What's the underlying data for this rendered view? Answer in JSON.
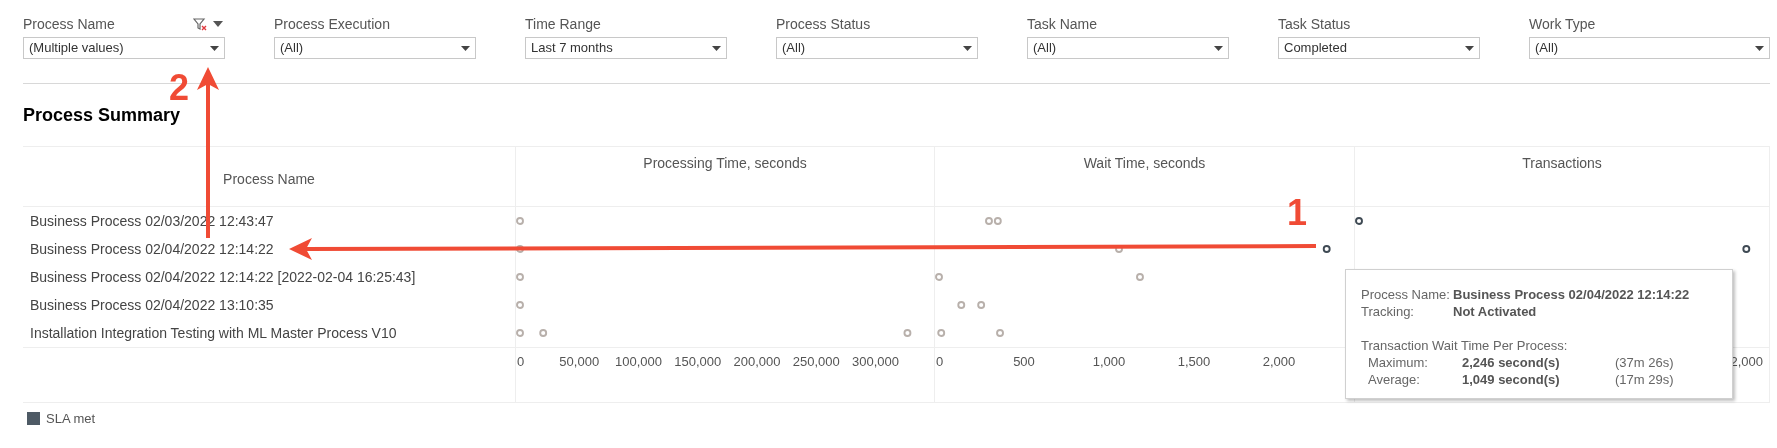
{
  "filters": [
    {
      "label": "Process Name",
      "value": "(Multiple values)",
      "filter_actions": true
    },
    {
      "label": "Process Execution",
      "value": "(All)",
      "filter_actions": false
    },
    {
      "label": "Time Range",
      "value": "Last 7 months",
      "filter_actions": false
    },
    {
      "label": "Process Status",
      "value": "(All)",
      "filter_actions": false
    },
    {
      "label": "Task Name",
      "value": "(All)",
      "filter_actions": false
    },
    {
      "label": "Task Status",
      "value": "Completed",
      "filter_actions": false
    },
    {
      "label": "Work Type",
      "value": "(All)",
      "filter_actions": false
    }
  ],
  "section_title": "Process Summary",
  "table": {
    "name_column": "Process Name",
    "rows": [
      "Business Process 02/03/2022 12:43:47",
      "Business Process 02/04/2022 12:14:22",
      "Business Process 02/04/2022 12:14:22 [2022-02-04 16:25:43]",
      "Business Process 02/04/2022 13:10:35",
      "Installation Integration Testing with ML Master Process V10"
    ],
    "columns": [
      {
        "title": "Processing Time, seconds",
        "axis_ticks": [
          "0",
          "50,000",
          "100,000",
          "150,000",
          "200,000",
          "250,000",
          "300,000"
        ]
      },
      {
        "title": "Wait Time, seconds",
        "axis_ticks": [
          "0",
          "500",
          "1,000",
          "1,500",
          "2,000"
        ]
      },
      {
        "title": "Transactions",
        "axis_ticks": [
          "2,000"
        ]
      }
    ]
  },
  "legend": [
    {
      "label": "SLA met",
      "color": "#4e5a65"
    }
  ],
  "tooltip": {
    "fields": [
      {
        "label": "Process Name:",
        "value": "Business Process 02/04/2022 12:14:22"
      },
      {
        "label": "Tracking:",
        "value": "Not Activated"
      }
    ],
    "section": "Transaction Wait Time Per Process:",
    "stats": [
      {
        "label": "Maximum:",
        "value": "2,246 second(s)",
        "note": "(37m 26s)"
      },
      {
        "label": "Average:",
        "value": "1,049 second(s)",
        "note": "(17m 29s)"
      }
    ]
  },
  "annotations": [
    {
      "text": "1"
    },
    {
      "text": "2"
    }
  ]
}
